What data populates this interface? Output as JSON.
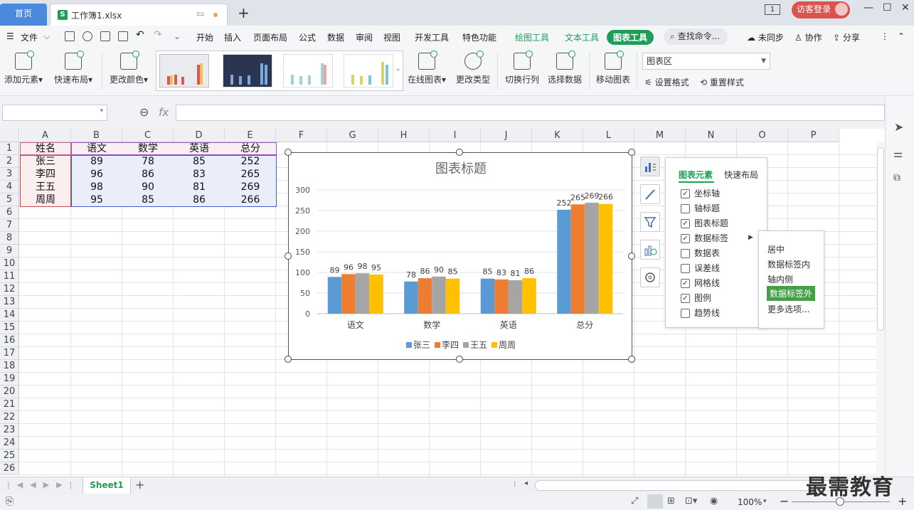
{
  "titlebar": {
    "home_tab": "首页",
    "doc_icon": "S",
    "doc_name": "工作簿1.xlsx",
    "new_tab": "+",
    "page_count": "1",
    "visitor_login": "访客登录"
  },
  "menubar": {
    "file": "文件",
    "items": [
      "开始",
      "插入",
      "页面布局",
      "公式",
      "数据",
      "审阅",
      "视图",
      "开发工具",
      "特色功能"
    ],
    "tool_tabs": [
      "绘图工具",
      "文本工具"
    ],
    "active_tab": "图表工具",
    "search": "查找命令...",
    "sync": "未同步",
    "collab": "协作",
    "share": "分享"
  },
  "ribbon": {
    "add_element": "添加元素",
    "quick_layout": "快速布局",
    "change_color": "更改颜色",
    "online_chart": "在线图表",
    "change_type": "更改类型",
    "switch_row_col": "切换行列",
    "select_data": "选择数据",
    "move_chart": "移动图表",
    "chart_area": "图表区",
    "set_format": "设置格式",
    "reset_style": "重置样式"
  },
  "formula": {
    "fx": "fx"
  },
  "sheet": {
    "columns": [
      "A",
      "B",
      "C",
      "D",
      "E",
      "F",
      "G",
      "H",
      "I",
      "J",
      "K",
      "L",
      "M",
      "N",
      "O",
      "P"
    ],
    "rows": [
      "1",
      "2",
      "3",
      "4",
      "5",
      "6",
      "7",
      "8",
      "9",
      "10",
      "11",
      "12",
      "13",
      "14",
      "15",
      "16",
      "17",
      "18",
      "19",
      "20",
      "21",
      "22",
      "23",
      "24",
      "25",
      "26"
    ],
    "header": [
      "姓名",
      "语文",
      "数学",
      "英语",
      "总分"
    ],
    "data": [
      [
        "张三",
        "89",
        "78",
        "85",
        "252"
      ],
      [
        "李四",
        "96",
        "86",
        "83",
        "265"
      ],
      [
        "王五",
        "98",
        "90",
        "81",
        "269"
      ],
      [
        "周周",
        "95",
        "85",
        "86",
        "266"
      ]
    ],
    "tab_name": "Sheet1"
  },
  "chart_data": {
    "type": "bar",
    "title": "图表标题",
    "categories": [
      "语文",
      "数学",
      "英语",
      "总分"
    ],
    "series": [
      {
        "name": "张三",
        "values": [
          89,
          78,
          85,
          252
        ],
        "color": "#5b9bd5"
      },
      {
        "name": "李四",
        "values": [
          96,
          86,
          83,
          265
        ],
        "color": "#ed7d31"
      },
      {
        "name": "王五",
        "values": [
          98,
          90,
          81,
          269
        ],
        "color": "#a5a5a5"
      },
      {
        "name": "周周",
        "values": [
          95,
          85,
          86,
          266
        ],
        "color": "#ffc000"
      }
    ],
    "ylim": [
      0,
      300
    ],
    "yticks": [
      "0",
      "50",
      "100",
      "150",
      "200",
      "250",
      "300"
    ],
    "grid": true,
    "legend": "bottom",
    "data_labels": true
  },
  "elements_panel": {
    "tab_elements": "图表元素",
    "tab_layout": "快速布局",
    "items": [
      {
        "label": "坐标轴",
        "checked": true
      },
      {
        "label": "轴标题",
        "checked": false
      },
      {
        "label": "图表标题",
        "checked": true
      },
      {
        "label": "数据标签",
        "checked": true
      },
      {
        "label": "数据表",
        "checked": false
      },
      {
        "label": "误差线",
        "checked": false
      },
      {
        "label": "网格线",
        "checked": true
      },
      {
        "label": "图例",
        "checked": true
      },
      {
        "label": "趋势线",
        "checked": false
      }
    ],
    "label_positions": [
      "居中",
      "数据标签内",
      "轴内侧",
      "数据标签外",
      "更多选项..."
    ],
    "selected_position": "数据标签外"
  },
  "status": {
    "zoom": "100%"
  },
  "watermark": "最需教育",
  "colors": {
    "accent": "#1e9e57",
    "home_tab": "#4b89dc",
    "visitor": "#d9534f"
  }
}
